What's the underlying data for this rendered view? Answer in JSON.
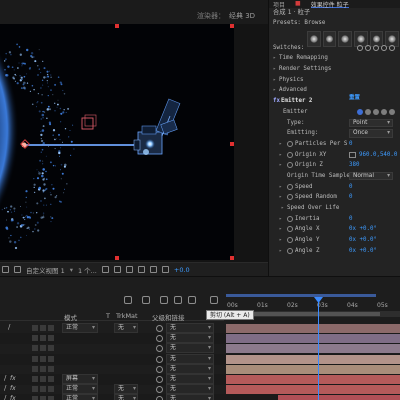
{
  "viewer": {
    "header_left": "渲染器：",
    "header_right": "经典 3D",
    "bottom_bar": {
      "view_dropdown": "自定义视图 1",
      "views_count": "1 个...",
      "exposure_value": "+0.0"
    }
  },
  "effects_panel": {
    "tabs": [
      "项目",
      "效果控件 粒子"
    ],
    "breadcrumb": "合成 1 · 粒子",
    "presets_label": "Presets: Browse",
    "rows": [
      {
        "name": "Switches:",
        "indent": 4,
        "kind": "switches"
      },
      {
        "name": "Time Remapping",
        "indent": 10,
        "kind": "group"
      },
      {
        "name": "Render Settings",
        "indent": 10,
        "kind": "group"
      },
      {
        "name": "Physics",
        "indent": 10,
        "kind": "group"
      },
      {
        "name": "Advanced",
        "indent": 10,
        "kind": "group"
      },
      {
        "name": "Emitter 2",
        "indent": 12,
        "kind": "header",
        "reset": "重置"
      },
      {
        "name": "Emitter",
        "indent": 14,
        "kind": "emitter"
      },
      {
        "name": "Type:",
        "indent": 18,
        "kind": "dropdown",
        "value": "Point"
      },
      {
        "name": "Emitting:",
        "indent": 18,
        "kind": "dropdown",
        "value": "Once"
      },
      {
        "name": "Particles Per S",
        "indent": 26,
        "kind": "param",
        "value": "0"
      },
      {
        "name": "Origin XY",
        "indent": 26,
        "kind": "origin",
        "value": "960.0,540.0"
      },
      {
        "name": "Origin Z",
        "indent": 26,
        "kind": "param",
        "value": "380"
      },
      {
        "name": "Origin Time Sample",
        "indent": 18,
        "kind": "dropdown",
        "value": "Normal"
      },
      {
        "name": "Speed",
        "indent": 26,
        "kind": "param",
        "value": "0"
      },
      {
        "name": "Speed Random",
        "indent": 26,
        "kind": "param",
        "value": "0"
      },
      {
        "name": "Speed Over Life",
        "indent": 18,
        "kind": "group"
      },
      {
        "name": "Inertia",
        "indent": 26,
        "kind": "param",
        "value": "0"
      },
      {
        "name": "Angle X",
        "indent": 26,
        "kind": "param",
        "value": "0x +0.0°"
      },
      {
        "name": "Angle Y",
        "indent": 26,
        "kind": "param",
        "value": "0x +0.0°"
      },
      {
        "name": "Angle Z",
        "indent": 26,
        "kind": "param",
        "value": "0x +0.0°"
      }
    ]
  },
  "timeline": {
    "ruler_ticks": [
      "00s",
      "01s",
      "02s",
      "03s",
      "04s",
      "05s"
    ],
    "tooltip": "剪切 (Alt + A)",
    "columns": {
      "mode": "模式",
      "t": "T",
      "trkmat": "TrkMat",
      "parent": "父级和链接"
    },
    "layers": [
      {
        "slash": true,
        "fx": false,
        "mode": "正常",
        "trkmat": "无",
        "parent": "无",
        "track_color": "#8c6a6a",
        "track_start": 0
      },
      {
        "slash": false,
        "fx": false,
        "mode": "",
        "trkmat": "",
        "parent": "无",
        "track_color": "#7f6d86",
        "track_start": 0
      },
      {
        "slash": false,
        "fx": false,
        "mode": "",
        "trkmat": "",
        "parent": "无",
        "track_color": "#8c7a8c",
        "track_start": 0
      },
      {
        "slash": false,
        "fx": false,
        "mode": "",
        "trkmat": "",
        "parent": "无",
        "track_color": "#b2938a",
        "track_start": 0
      },
      {
        "slash": false,
        "fx": false,
        "mode": "",
        "trkmat": "",
        "parent": "无",
        "track_color": "#a88d7a",
        "track_start": 0
      },
      {
        "slash": true,
        "fx": true,
        "mode": "屏幕",
        "trkmat": "",
        "parent": "无",
        "track_color": "#b45a5a",
        "track_start": 0
      },
      {
        "slash": true,
        "fx": true,
        "mode": "正常",
        "trkmat": "无",
        "parent": "无",
        "track_color": "#b45a5a",
        "track_start": 0
      },
      {
        "slash": true,
        "fx": true,
        "mode": "正常",
        "trkmat": "无",
        "parent": "无",
        "track_color": "#b04f56",
        "track_start": 0.3
      }
    ]
  },
  "colors": {
    "accent": "#3b8bff",
    "handle": "#e03030"
  }
}
